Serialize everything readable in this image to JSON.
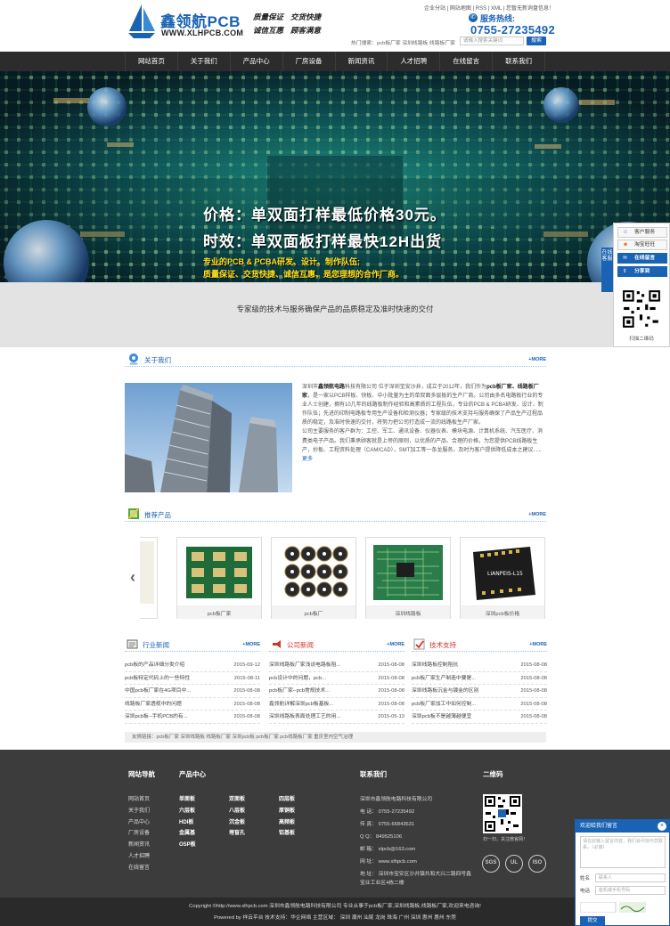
{
  "header": {
    "logo_cn": "鑫领航PCB",
    "logo_en": "WWW.XLHPCB.COM",
    "slogan": [
      "质量保证",
      "交货快捷",
      "诚信互惠",
      "顾客满意"
    ],
    "toplinks": "企业分站 | 网站地图 | RSS | XML | 您暂无新询盘信息！",
    "hotline_label": "服务热线:",
    "hotline_number": "0755-27235492",
    "hot_search": "热门搜索：pcb板厂家 深圳线路板 线路板厂家",
    "search_placeholder": "请输入搜索关键词",
    "search_button": "搜索"
  },
  "nav": [
    "网站首页",
    "关于我们",
    "产品中心",
    "厂房设备",
    "新闻资讯",
    "人才招聘",
    "在线留言",
    "联系我们"
  ],
  "banner": {
    "line1": "价格：单双面打样最低价格30元。",
    "line2": "时效：单双面板打样最快12H出货",
    "line3": "专业的PCB & PCBA研发、设计、制作队伍;",
    "line4": "质量保证、交货快捷、诚信互惠、是您理想的合作厂商。",
    "active_slide": 3
  },
  "tagline": "专家级的技术与服务确保产品的品质稳定及准时快速的交付",
  "about": {
    "title": "关于我们",
    "more": "+MORE",
    "text_lead": "深圳市",
    "company": "鑫领航电路",
    "text_1": "科技有限公司 位于深圳宝安沙井，成立于2012年，我们作为",
    "bold_2": "pcb板厂家、线路板厂家",
    "text_2": "，是一家以PCB样板、快板、中小批量为主的单双面多层板的生产厂商。公司由多名电路板行业的专业人士创建，拥有10几年的线路板制作经验和高素质的工程队伍，专业的PCB & PCBA研发、设计、制作队伍；先进的印制电路板专用生产设备和检测仪器；专家级的技术支持与服务确保了产品生产过程品质的稳定，及准时快速的交付，将努力把公司打造成一流的线路板生产厂家。",
    "text_3": "公司主要服务的客户群为：工控、军工、通讯设备、仪器仪表、模块电源、计算机系统、汽车医疗、消费类电子产品。我们秉承顾客就是上帝的原则，以优质的产品、合理的价格，为您提供PCB线路板生产，抄板、工程资料处理（CAM/CAD），SMT加工等一条龙服务，及时为客户提供降低成本之建议．．．",
    "more_link": "更多"
  },
  "products": {
    "title": "推荐产品",
    "more": "+MORE",
    "items": [
      {
        "caption": "pcb板厂家"
      },
      {
        "caption": "pcb板厂"
      },
      {
        "caption": "深圳线路板"
      },
      {
        "caption": "深圳pcb板价格"
      }
    ]
  },
  "news": [
    {
      "title": "行业新闻",
      "more": "+MORE",
      "color": "#1a62b3",
      "items": [
        {
          "t": "pcb板的产品详细分类介绍",
          "d": "2015-09-12"
        },
        {
          "t": "pcb板特定代码上的一些特性",
          "d": "2015-08-11"
        },
        {
          "t": "中国pcb板厂家在4G项目中...",
          "d": "2015-08-08"
        },
        {
          "t": "线路板厂家透视中的问题",
          "d": "2015-08-08"
        },
        {
          "t": "深圳pcb板--手机PCB的有...",
          "d": "2015-08-08"
        }
      ]
    },
    {
      "title": "公司新闻",
      "more": "+MORE",
      "color": "#d9312a",
      "items": [
        {
          "t": "深圳线路板厂家浅谈电路板阻...",
          "d": "2015-08-08"
        },
        {
          "t": "pcb设计中的问题，pcb...",
          "d": "2015-08-08"
        },
        {
          "t": "pcb板厂家--pcb常规技术...",
          "d": "2015-08-08"
        },
        {
          "t": "鑫领航详解深圳pcb板基板...",
          "d": "2015-08-08"
        },
        {
          "t": "深圳线路板表面处理工艺的用...",
          "d": "2015-05-13"
        }
      ]
    },
    {
      "title": "技术支持",
      "more": "+MORE",
      "color": "#d9312a",
      "items": [
        {
          "t": "深圳线路板控制阻抗",
          "d": "2015-08-08"
        },
        {
          "t": "pcb板厂家生产制造中要是...",
          "d": "2015-08-08"
        },
        {
          "t": "深圳线路板沉金与镀金的区别",
          "d": "2015-08-08"
        },
        {
          "t": "pcb板厂家加工中如何控制...",
          "d": "2015-08-08"
        },
        {
          "t": "深圳pcb板不是越薄越便宜",
          "d": "2015-08-08"
        }
      ]
    }
  ],
  "friend_links": "友情链接：pcb板厂家 深圳线路板 线路板厂家 深圳pcb板 pcb板厂家 pcb线路板厂家 重庆室内空气治理",
  "footer": {
    "nav_title": "网站导航",
    "nav_items": [
      "网站首页",
      "关于我们",
      "产品中心",
      "厂房设备",
      "新闻资讯",
      "人才招聘",
      "在线留言"
    ],
    "product_title": "产品中心",
    "product_items": [
      "单面板",
      "双面板",
      "四层板",
      "六层板",
      "八层板",
      "厚铜板",
      "HDI板",
      "沉金板",
      "高频板",
      "金属基",
      "埋盲孔",
      "铝基板",
      "OSP板"
    ],
    "contact_title": "联系我们",
    "contact_lines": [
      "深圳市鑫领航电路科技有限公司",
      "电 话： 0755-27235492",
      "传 真： 0755-66843631",
      "Q Q： 849525106",
      "邮 箱： xlpcb@163.com",
      "网 址： www.xlhpcb.com",
      "地 址： 深圳市宝安区沙井镇共和大兴二路四号鑫宝业工业区4栋二楼"
    ],
    "qr_title": "二维码",
    "qr_caption": "扫一扫，关注微官网！",
    "certs": [
      "SGS",
      "UL",
      "ISO"
    ],
    "copy1": "Copyright ©http://www.xlhpcb.com 深圳市鑫领航电路科技有限公司 专业从事于pcb板厂家,深圳线路板,线路板厂家,欢迎来电咨询!",
    "copy2": "Powered by 祥云平台  技术支持：华企网络   主营区域： 深圳 潮州 汕尾 龙岗 珠海 广州 深圳 惠州 惠州 东莞"
  },
  "float_service": {
    "tab": "在线客服",
    "items": [
      "客户服务",
      "淘宝旺旺",
      "在线留言",
      "分享到"
    ],
    "qr_caption": "扫描二维码"
  },
  "message_box": {
    "title": "欢迎给我们留言",
    "close": "×",
    "placeholder": "请在此输入留言内容，我们会尽快与您联系。（必填）",
    "name_label": "姓名",
    "name_placeholder": "联系人",
    "phone_label": "电话",
    "phone_placeholder": "座机或手机号码",
    "submit": "提交"
  }
}
